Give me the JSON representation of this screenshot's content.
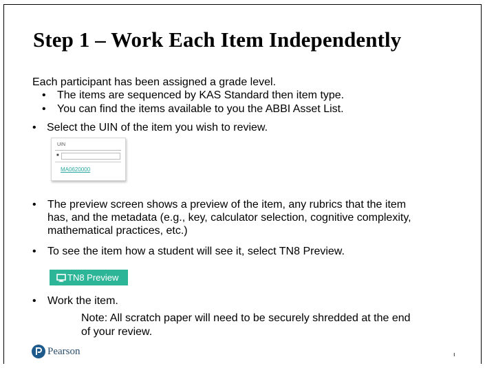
{
  "title": "Step 1 – Work Each Item Independently",
  "intro": "Each participant has been assigned a grade level.",
  "sub_bullets": [
    "The items are sequenced by KAS Standard then item type.",
    "You can find the items available to you   the ABBI Asset List."
  ],
  "bullets": {
    "select_uin": "Select the UIN of the item you wish to review.",
    "preview_lines": [
      "The preview screen shows a preview of the item, any rubrics that the item",
      "has, and the metadata (e.g., key, calculator selection, cognitive complexity,",
      "mathematical practices, etc.)"
    ],
    "see_item": "To see the item how a student will see it, select TN8 Preview.",
    "work_item": "Work the item."
  },
  "bullet_char": "•",
  "note_lines": [
    "Note: All scratch paper will need to be securely shredded at the end",
    "of your review."
  ],
  "uin_widget": {
    "label": "UIN",
    "filter_icon": "filter-icon",
    "link": "MA0620000"
  },
  "tn8_button": {
    "label": "TN8 Preview",
    "icon": "monitor-icon",
    "color": "#2db598"
  },
  "logo": {
    "text": "Pearson",
    "icon": "pearson-p-logo",
    "color": "#2a4d6a"
  },
  "page_number": "ı"
}
